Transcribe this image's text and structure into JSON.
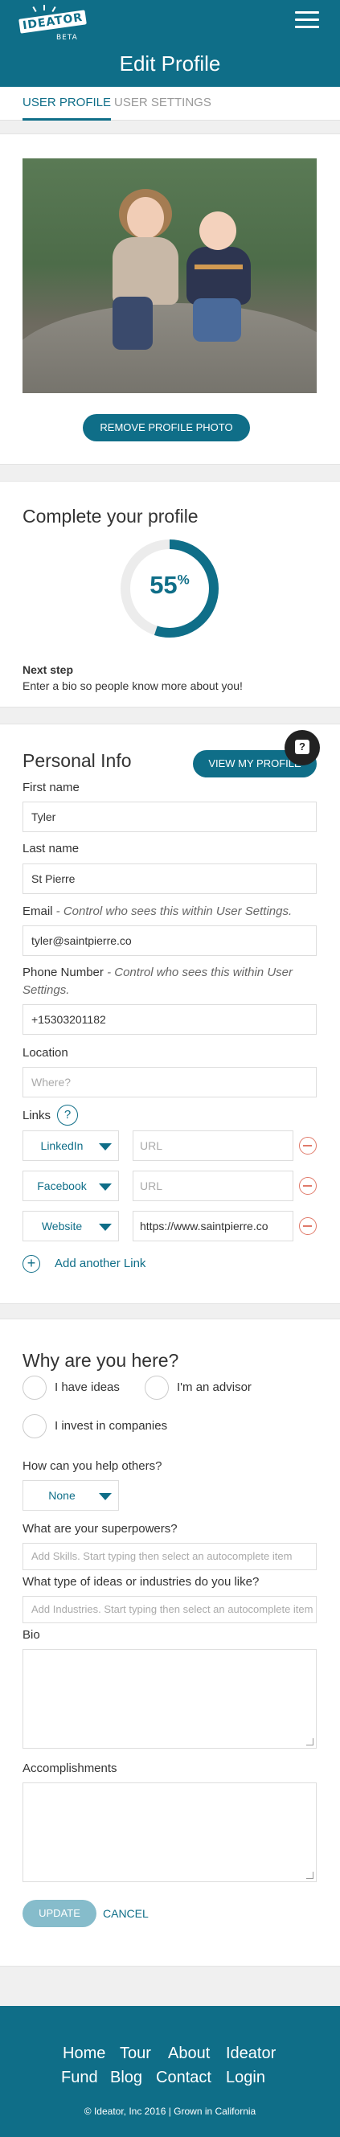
{
  "brand": {
    "logo_text": "IDEATOR",
    "badge": "BETA"
  },
  "header": {
    "title": "Edit Profile",
    "menu_icon": "hamburger-menu-icon"
  },
  "tabs": [
    {
      "label": "USER PROFILE",
      "active": true
    },
    {
      "label": "USER SETTINGS",
      "active": false
    }
  ],
  "photo": {
    "remove_label": "REMOVE PROFILE PHOTO"
  },
  "completion": {
    "title": "Complete your profile",
    "percent": 55,
    "percent_value": "55",
    "percent_sign": "%",
    "next_step_heading": "Next step",
    "next_step_text": "Enter a bio so people know more about you!"
  },
  "personal": {
    "title": "Personal Info",
    "view_profile_label": "VIEW MY PROFILE",
    "first_name_label": "First name",
    "first_name": "Tyler",
    "last_name_label": "Last name",
    "last_name": "St Pierre",
    "email_label": "Email",
    "email_note": " - Control who sees this within User Settings.",
    "email": "tyler@saintpierre.co",
    "phone_label": "Phone Number",
    "phone_note": " - Control who sees this within User Settings.",
    "phone": "+15303201182",
    "location_label": "Location",
    "location_placeholder": "Where?",
    "links_label": "Links",
    "help_glyph": "?",
    "links": [
      {
        "type": "LinkedIn",
        "url": "",
        "url_placeholder": "URL"
      },
      {
        "type": "Facebook",
        "url": "",
        "url_placeholder": "URL"
      },
      {
        "type": "Website",
        "url": "https://www.saintpierre.co",
        "url_placeholder": "URL"
      }
    ],
    "add_link_glyph": "+",
    "add_link_label": "Add another Link"
  },
  "why": {
    "title": "Why are you here?",
    "options": [
      "I have ideas",
      "I'm an advisor",
      "I invest in companies"
    ],
    "help_label": "How can you help others?",
    "help_value": "None",
    "superpowers_label": "What are your superpowers?",
    "superpowers_placeholder": "Add Skills. Start typing then select an autocomplete item",
    "industries_label": "What type of ideas or industries do you like?",
    "industries_placeholder": "Add Industries. Start typing then select an autocomplete item",
    "bio_label": "Bio",
    "accomplishments_label": "Accomplishments",
    "update_label": "UPDATE",
    "cancel_label": "CANCEL"
  },
  "help_bubble": {
    "glyph": "?"
  },
  "footer": {
    "row1": [
      "Home",
      "Tour",
      "About",
      "Ideator"
    ],
    "row2": [
      "Fund",
      "Blog",
      "Contact",
      "Login"
    ],
    "copyright": "© Ideator, Inc 2016   |   Grown in California"
  },
  "colors": {
    "brand": "#0f6e88",
    "danger": "#e07a6a",
    "update_button": "#86bccb"
  }
}
